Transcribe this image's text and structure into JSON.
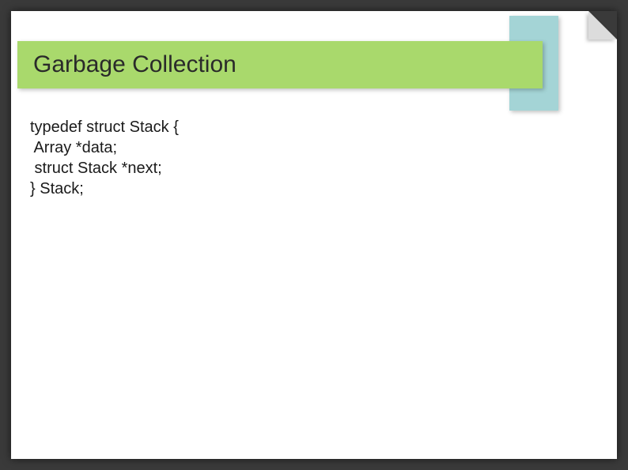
{
  "title": "Garbage Collection",
  "code": {
    "l1": "typedef struct Stack {",
    "l2": " Array *data;",
    "l3": " struct Stack *next;",
    "l4": "} Stack;"
  },
  "colors": {
    "title_bar": "#a9d96c",
    "accent_box": "#a4d4d6",
    "slide_bg": "#ffffff",
    "outer_bg": "#3a3a3a"
  }
}
